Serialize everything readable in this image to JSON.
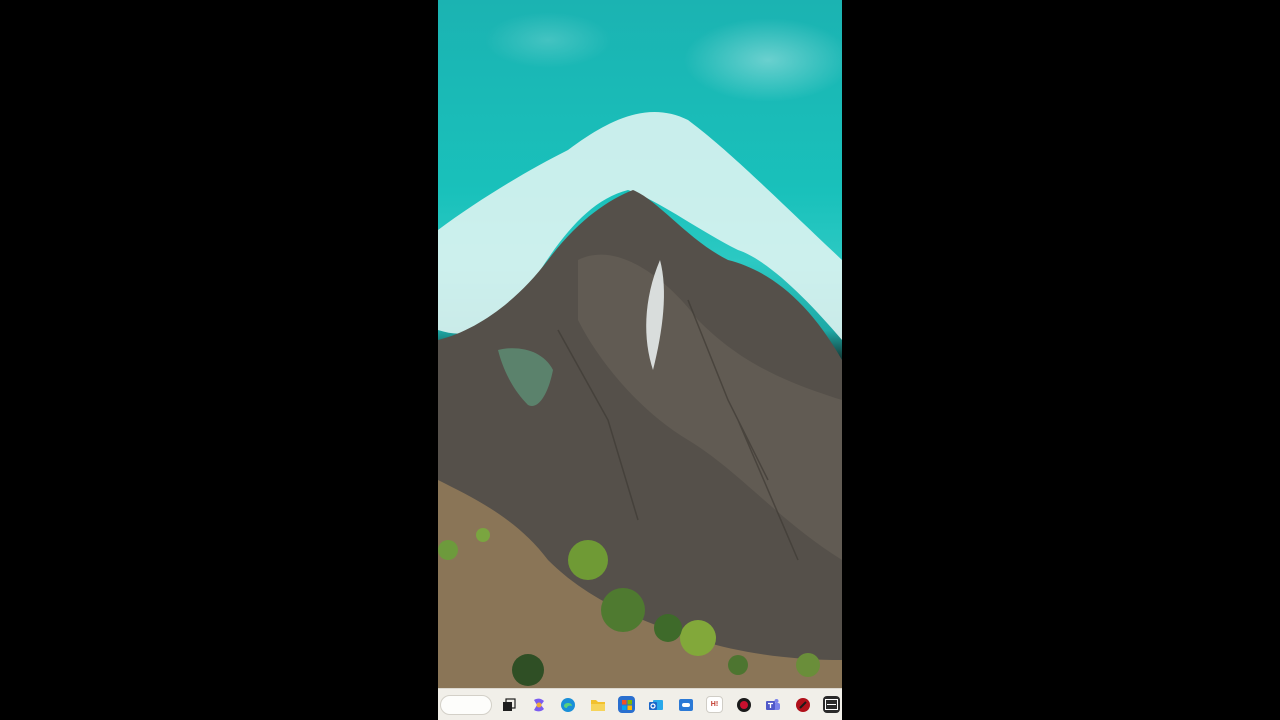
{
  "wallpaper": {
    "subject": "aerial-coastline-rocks",
    "colors": {
      "sea": "#1bb3b2",
      "foam": "#e8f6f4",
      "rock": "#58534d",
      "vegetation": "#5f8a3a",
      "letterbox": "#000000"
    }
  },
  "taskbar": {
    "background": "#f1efe9",
    "search": {
      "placeholder": ""
    },
    "icons": [
      {
        "name": "task-view-icon",
        "color": "#1e1e1e"
      },
      {
        "name": "copilot-icon",
        "color": "#7b5cf0"
      },
      {
        "name": "edge-icon",
        "color": "#1a8fd8"
      },
      {
        "name": "file-explorer-icon",
        "color": "#f2c12e"
      },
      {
        "name": "microsoft-store-icon",
        "color": "#2a6fcf"
      },
      {
        "name": "outlook-icon",
        "color": "#1b66c9"
      },
      {
        "name": "xbox-game-bar-icon",
        "color": "#2b79d6"
      },
      {
        "name": "notepad-icon",
        "color": "#ffffff",
        "label": "H!"
      },
      {
        "name": "record-app-icon",
        "color": "#c8102e"
      },
      {
        "name": "teams-icon",
        "color": "#6264a7"
      },
      {
        "name": "media-app-icon",
        "color": "#b0101a"
      },
      {
        "name": "screen-recorder-icon",
        "color": "#2a2a2a"
      }
    ]
  }
}
